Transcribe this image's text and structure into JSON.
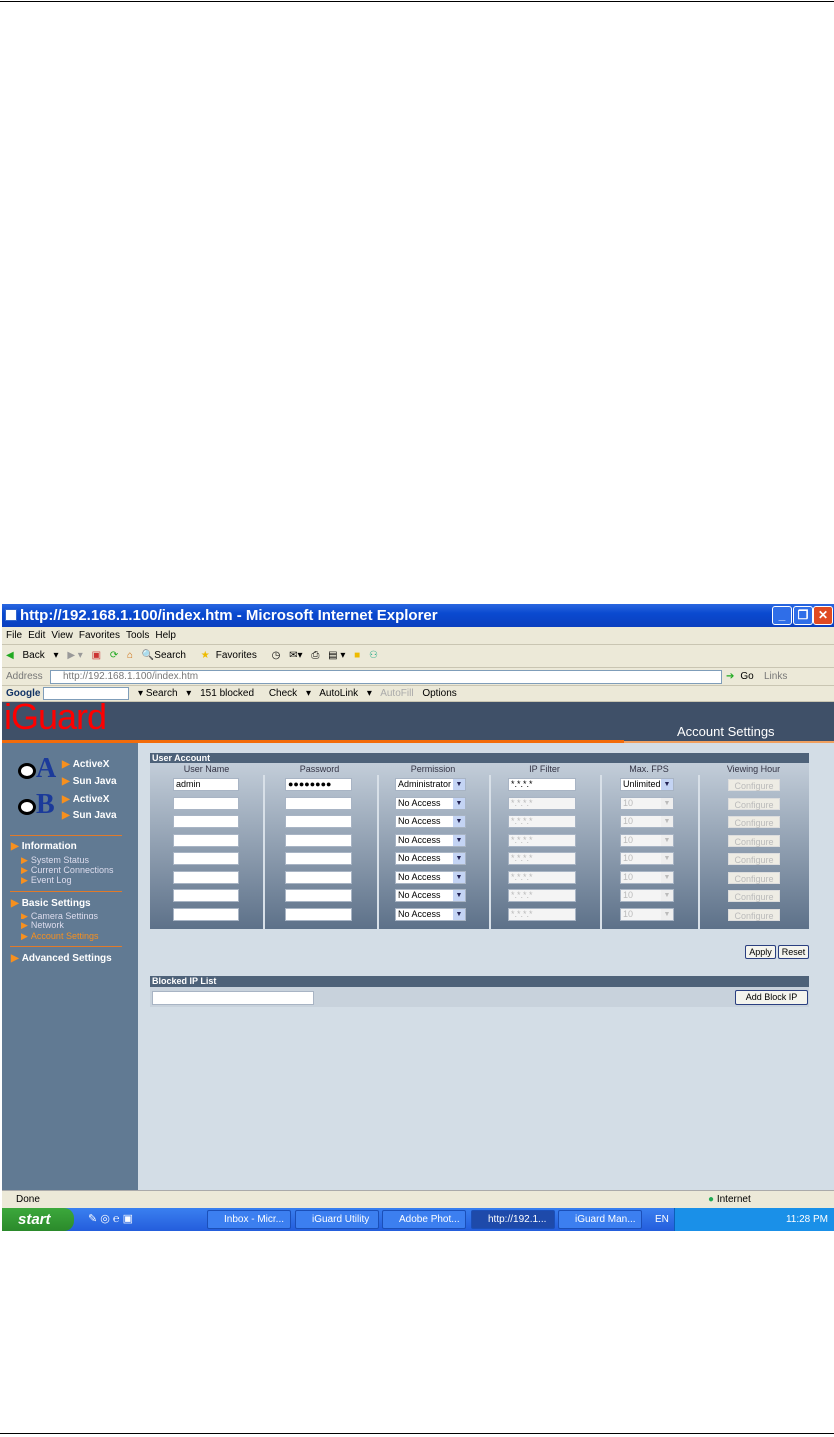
{
  "window": {
    "title": "http://192.168.1.100/index.htm - Microsoft Internet Explorer"
  },
  "menu": [
    "File",
    "Edit",
    "View",
    "Favorites",
    "Tools",
    "Help"
  ],
  "toolbar": {
    "back": "Back",
    "search": "Search",
    "favorites": "Favorites"
  },
  "address": {
    "label": "Address",
    "value": "http://192.168.1.100/index.htm",
    "go": "Go",
    "links": "Links"
  },
  "google": {
    "logo": "Google",
    "search": "Search",
    "blocked": "151 blocked",
    "check": "Check",
    "autolink": "AutoLink",
    "autofill": "AutoFill",
    "options": "Options"
  },
  "app": {
    "logo": "iGuard",
    "page_title": "Account Settings"
  },
  "sidebar": {
    "camA": {
      "activex": "ActiveX",
      "java": "Sun Java",
      "letter": "A"
    },
    "camB": {
      "activex": "ActiveX",
      "java": "Sun Java",
      "letter": "B"
    },
    "information": {
      "label": "Information",
      "items": [
        "System Status",
        "Current Connections",
        "Event Log"
      ]
    },
    "basic": {
      "label": "Basic Settings",
      "items": [
        "Camera Settings",
        "Network",
        "Account Settings"
      ]
    },
    "advanced": {
      "label": "Advanced Settings"
    }
  },
  "user_account": {
    "title": "User Account",
    "columns": [
      "User Name",
      "Password",
      "Permission",
      "IP Filter",
      "Max. FPS",
      "Viewing Hour"
    ],
    "rows": [
      {
        "user": "admin",
        "password": "●●●●●●●●",
        "permission": "Administrator",
        "ip": "*.*.*.*",
        "fps": "Unlimited",
        "hour": "Configure"
      },
      {
        "user": "",
        "password": "",
        "permission": "No Access",
        "ip": "*.*.*.*",
        "fps": "10",
        "hour": "Configure"
      },
      {
        "user": "",
        "password": "",
        "permission": "No Access",
        "ip": "*.*.*.*",
        "fps": "10",
        "hour": "Configure"
      },
      {
        "user": "",
        "password": "",
        "permission": "No Access",
        "ip": "*.*.*.*",
        "fps": "10",
        "hour": "Configure"
      },
      {
        "user": "",
        "password": "",
        "permission": "No Access",
        "ip": "*.*.*.*",
        "fps": "10",
        "hour": "Configure"
      },
      {
        "user": "",
        "password": "",
        "permission": "No Access",
        "ip": "*.*.*.*",
        "fps": "10",
        "hour": "Configure"
      },
      {
        "user": "",
        "password": "",
        "permission": "No Access",
        "ip": "*.*.*.*",
        "fps": "10",
        "hour": "Configure"
      },
      {
        "user": "",
        "password": "",
        "permission": "No Access",
        "ip": "*.*.*.*",
        "fps": "10",
        "hour": "Configure"
      }
    ],
    "apply": "Apply",
    "reset": "Reset"
  },
  "blocked": {
    "title": "Blocked IP List",
    "input": "",
    "add": "Add Block IP"
  },
  "status": {
    "text": "Done",
    "zone": "Internet"
  },
  "taskbar": {
    "start": "start",
    "items": [
      "Inbox - Micr...",
      "iGuard Utility",
      "Adobe Phot...",
      "http://192.1...",
      "iGuard Man..."
    ],
    "lang": "EN",
    "clock": "11:28 PM"
  }
}
